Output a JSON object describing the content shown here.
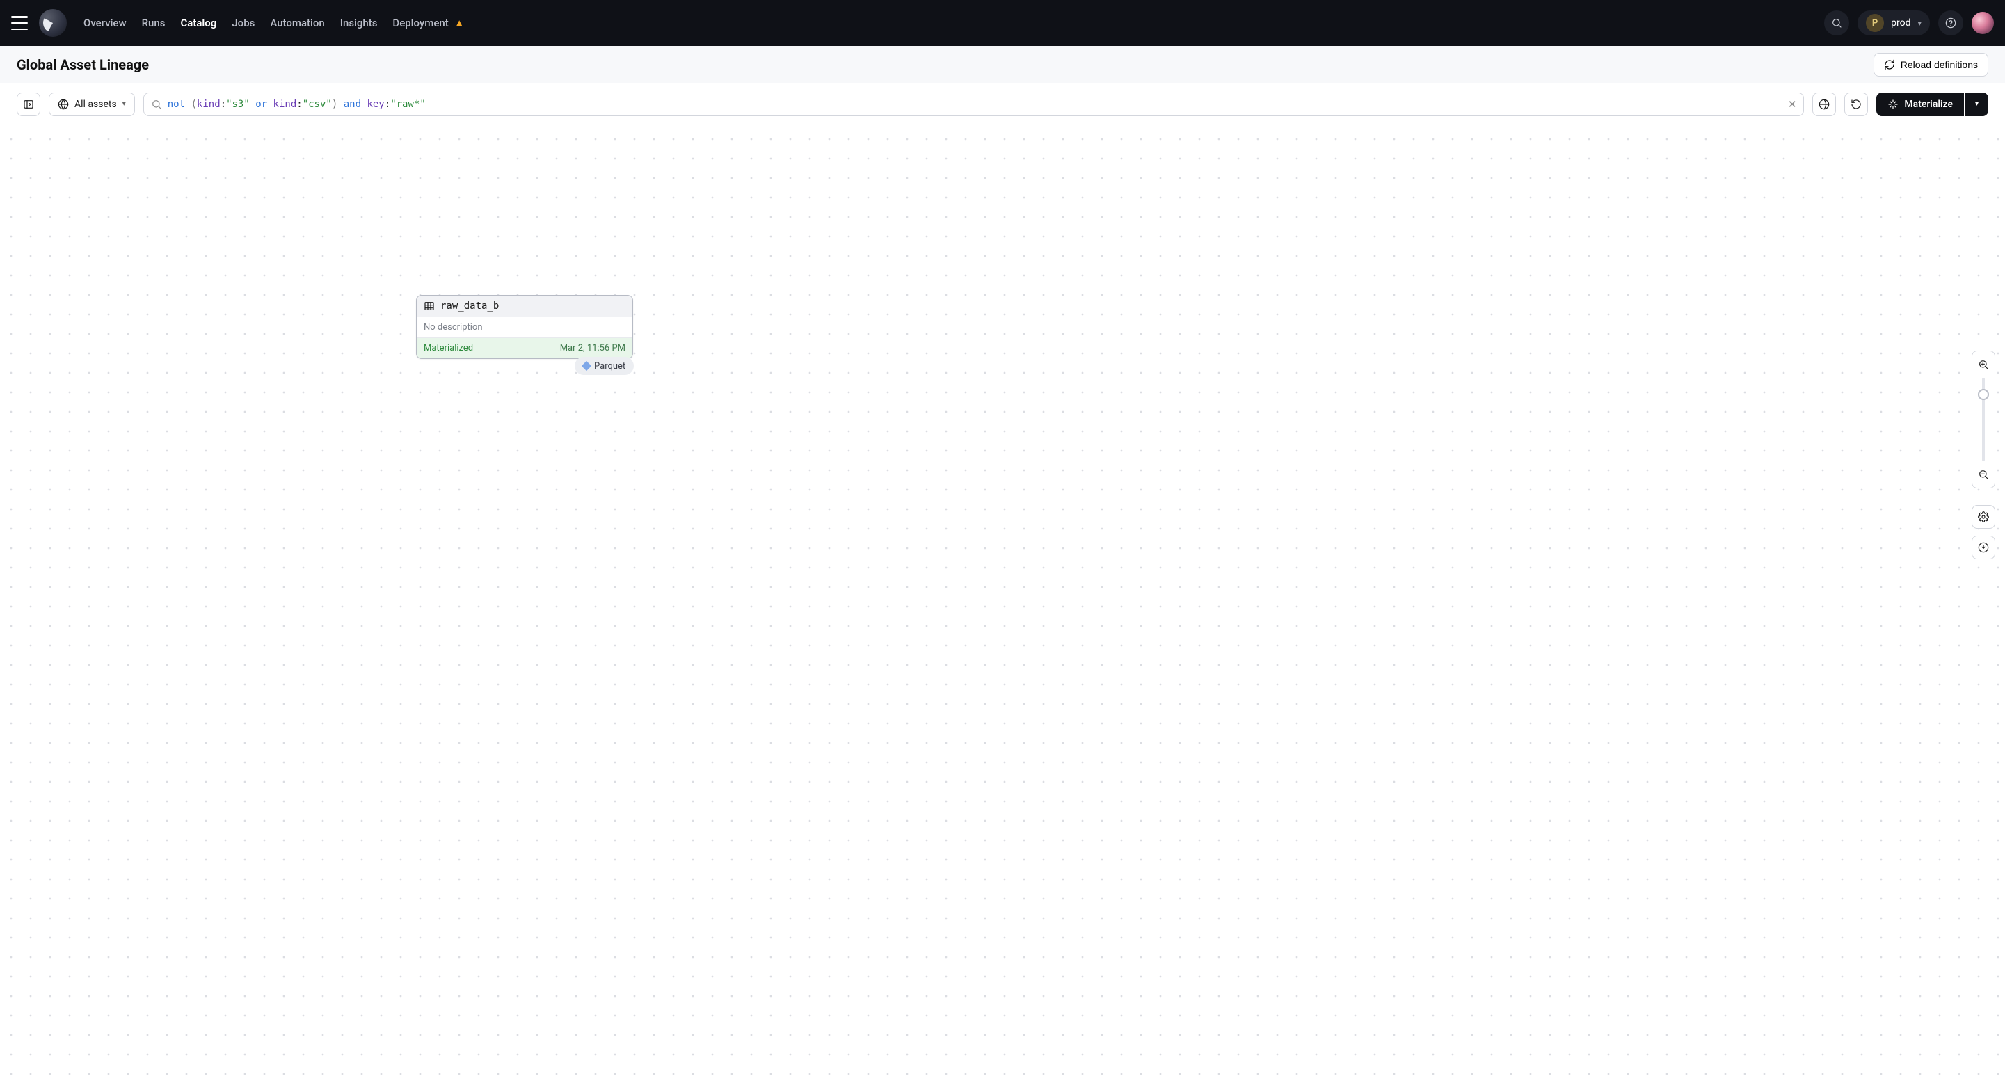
{
  "nav": {
    "links": [
      "Overview",
      "Runs",
      "Catalog",
      "Jobs",
      "Automation",
      "Insights",
      "Deployment"
    ],
    "active": "Catalog"
  },
  "env": {
    "badge": "P",
    "name": "prod"
  },
  "subheader": {
    "title": "Global Asset Lineage",
    "reload_label": "Reload definitions"
  },
  "toolbar": {
    "scope_label": "All assets",
    "materialize_label": "Materialize",
    "query": {
      "raw": "not (kind:\"s3\" or kind:\"csv\") and key:\"raw*\"",
      "tokens": [
        {
          "t": "kw-not",
          "v": "not"
        },
        {
          "t": "sp",
          "v": " "
        },
        {
          "t": "paren",
          "v": "("
        },
        {
          "t": "field",
          "v": "kind"
        },
        {
          "t": "colon",
          "v": ":"
        },
        {
          "t": "str",
          "v": "\"s3\""
        },
        {
          "t": "sp",
          "v": " "
        },
        {
          "t": "kw-or",
          "v": "or"
        },
        {
          "t": "sp",
          "v": " "
        },
        {
          "t": "field",
          "v": "kind"
        },
        {
          "t": "colon",
          "v": ":"
        },
        {
          "t": "str",
          "v": "\"csv\""
        },
        {
          "t": "paren",
          "v": ")"
        },
        {
          "t": "sp",
          "v": " "
        },
        {
          "t": "kw-and",
          "v": "and"
        },
        {
          "t": "sp",
          "v": " "
        },
        {
          "t": "field",
          "v": "key"
        },
        {
          "t": "colon",
          "v": ":"
        },
        {
          "t": "str",
          "v": "\"raw*\""
        }
      ]
    }
  },
  "node": {
    "name": "raw_data_b",
    "description": "No description",
    "status": "Materialized",
    "timestamp": "Mar 2, 11:56 PM",
    "tag": "Parquet"
  }
}
